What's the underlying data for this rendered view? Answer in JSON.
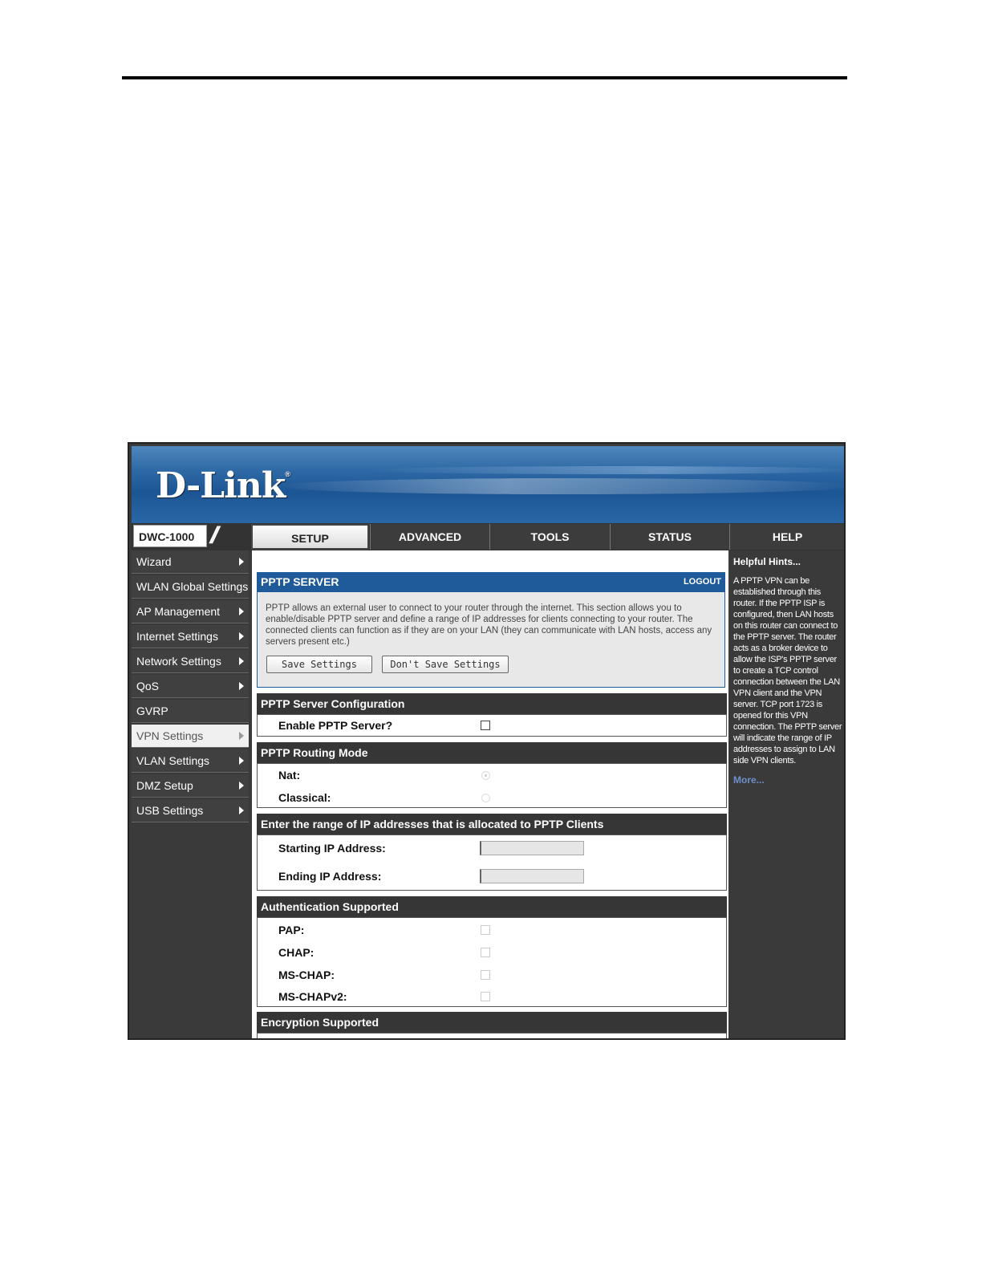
{
  "brand": {
    "logo_text": "D-Link",
    "reg_mark": "®",
    "model": "DWC-1000",
    "accent": "#1f5a9a"
  },
  "tabs": [
    {
      "label": "SETUP",
      "active": true
    },
    {
      "label": "ADVANCED",
      "active": false
    },
    {
      "label": "TOOLS",
      "active": false
    },
    {
      "label": "STATUS",
      "active": false
    },
    {
      "label": "HELP",
      "active": false
    }
  ],
  "sidebar": {
    "items": [
      {
        "label": "Wizard"
      },
      {
        "label": "WLAN Global Settings"
      },
      {
        "label": "AP Management"
      },
      {
        "label": "Internet Settings"
      },
      {
        "label": "Network Settings"
      },
      {
        "label": "QoS"
      },
      {
        "label": "GVRP"
      },
      {
        "label": "VPN Settings",
        "active": true
      },
      {
        "label": "VLAN Settings"
      },
      {
        "label": "DMZ Setup"
      },
      {
        "label": "USB Settings"
      }
    ]
  },
  "panel": {
    "title": "PPTP SERVER",
    "logout": "LOGOUT",
    "description": "PPTP allows an external user to connect to your router through the internet. This section allows you to enable/disable PPTP server and define a range of IP addresses for clients connecting to your router. The connected clients can function as if they are on your LAN (they can communicate with LAN hosts, access any servers present etc.)",
    "save_label": "Save Settings",
    "dont_save_label": "Don't Save Settings"
  },
  "server_config": {
    "title": "PPTP Server Configuration",
    "enable_label": "Enable PPTP Server?",
    "enabled": false
  },
  "routing": {
    "title": "PPTP Routing Mode",
    "nat_label": "Nat:",
    "classical_label": "Classical:",
    "selected": "Nat"
  },
  "ip_range": {
    "title": "Enter the range of IP addresses that is allocated to PPTP Clients",
    "start_label": "Starting IP Address:",
    "end_label": "Ending IP Address:",
    "start_value": "",
    "end_value": ""
  },
  "auth": {
    "title": "Authentication Supported",
    "pap": "PAP:",
    "chap": "CHAP:",
    "mschap": "MS-CHAP:",
    "mschapv2": "MS-CHAPv2:"
  },
  "encryption": {
    "title": "Encryption Supported"
  },
  "help": {
    "title": "Helpful Hints...",
    "text": "A PPTP VPN can be established through this router. If the PPTP ISP is configured, then LAN hosts on this router can connect to the PPTP server. The router acts as a broker device to allow the ISP's PPTP server to create a TCP control connection between the LAN VPN client and the VPN server. TCP port 1723 is opened for this VPN connection. The PPTP server will indicate the range of IP addresses to assign to LAN side VPN clients.",
    "more": "More..."
  }
}
